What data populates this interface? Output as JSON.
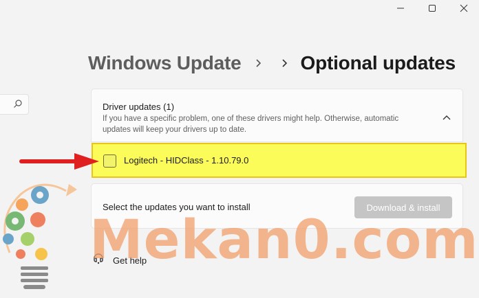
{
  "window": {
    "controls": [
      "minimize-icon",
      "maximize-icon",
      "close-icon"
    ]
  },
  "breadcrumb": {
    "parent": "Windows Update",
    "current": "Optional updates"
  },
  "driver_updates": {
    "title": "Driver updates (1)",
    "description": "If you have a specific problem, one of these drivers might help. Otherwise, automatic updates will keep your drivers up to date.",
    "items": [
      {
        "label": "Logitech - HIDClass - 1.10.79.0",
        "checked": false
      }
    ]
  },
  "install": {
    "text": "Select the updates you want to install",
    "button_label": "Download & install"
  },
  "help": {
    "label": "Get help"
  },
  "watermark": {
    "text": "Mekan0.com"
  },
  "colors": {
    "highlight_fill": "#fbfb5a",
    "highlight_border": "#e8c417",
    "arrow": "#e02020",
    "watermark": "#f2a06a",
    "disabled_button": "#c5c5c5"
  }
}
